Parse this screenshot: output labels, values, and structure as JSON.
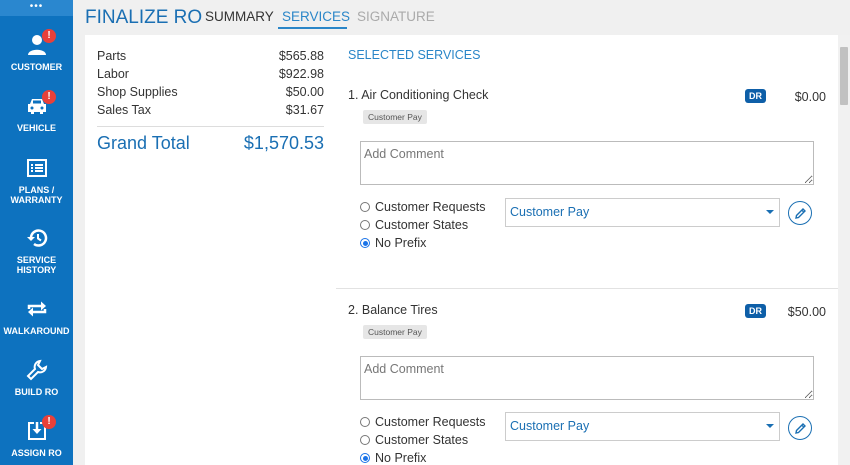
{
  "sidebar": {
    "top_label": "•••",
    "items": [
      {
        "label": "CUSTOMER",
        "badge": "!",
        "icon": "person-icon"
      },
      {
        "label": "VEHICLE",
        "badge": "!",
        "icon": "car-icon"
      },
      {
        "label_line1": "PLANS /",
        "label_line2": "WARRANTY",
        "icon": "list-icon"
      },
      {
        "label_line1": "SERVICE",
        "label_line2": "HISTORY",
        "icon": "history-icon"
      },
      {
        "label": "WALKAROUND",
        "icon": "repeat-icon"
      },
      {
        "label": "BUILD RO",
        "icon": "wrench-icon"
      },
      {
        "label": "ASSIGN RO",
        "badge": "!",
        "icon": "download-box-icon"
      }
    ]
  },
  "header": {
    "title": "FINALIZE RO",
    "tabs": [
      {
        "label": "SUMMARY",
        "state": "normal"
      },
      {
        "label": "SERVICES",
        "state": "active"
      },
      {
        "label": "SIGNATURE",
        "state": "disabled"
      }
    ]
  },
  "summary": {
    "rows": [
      {
        "label": "Parts",
        "value": "$565.88"
      },
      {
        "label": "Labor",
        "value": "$922.98"
      },
      {
        "label": "Shop Supplies",
        "value": "$50.00"
      },
      {
        "label": "Sales Tax",
        "value": "$31.67"
      }
    ],
    "grand_total_label": "Grand Total",
    "grand_total_value": "$1,570.53"
  },
  "services": {
    "heading": "SELECTED SERVICES",
    "items": [
      {
        "title": "1.  Air Conditioning Check",
        "tag": "Customer Pay",
        "badge": "DR",
        "price": "$0.00",
        "comment_placeholder": "Add Comment",
        "radios": [
          "Customer Requests",
          "Customer States",
          "No Prefix"
        ],
        "selected_radio": "No Prefix",
        "pay_type": "Customer Pay"
      },
      {
        "title": "2.  Balance Tires",
        "tag": "Customer Pay",
        "badge": "DR",
        "price": "$50.00",
        "comment_placeholder": "Add Comment",
        "radios": [
          "Customer Requests",
          "Customer States",
          "No Prefix"
        ],
        "selected_radio": "No Prefix",
        "pay_type": "Customer Pay"
      }
    ]
  },
  "colors": {
    "sidebar_bg": "#0d72bf",
    "accent": "#1a6fb3",
    "badge_red": "#e8403a",
    "dr_badge": "#0e5fa8"
  }
}
